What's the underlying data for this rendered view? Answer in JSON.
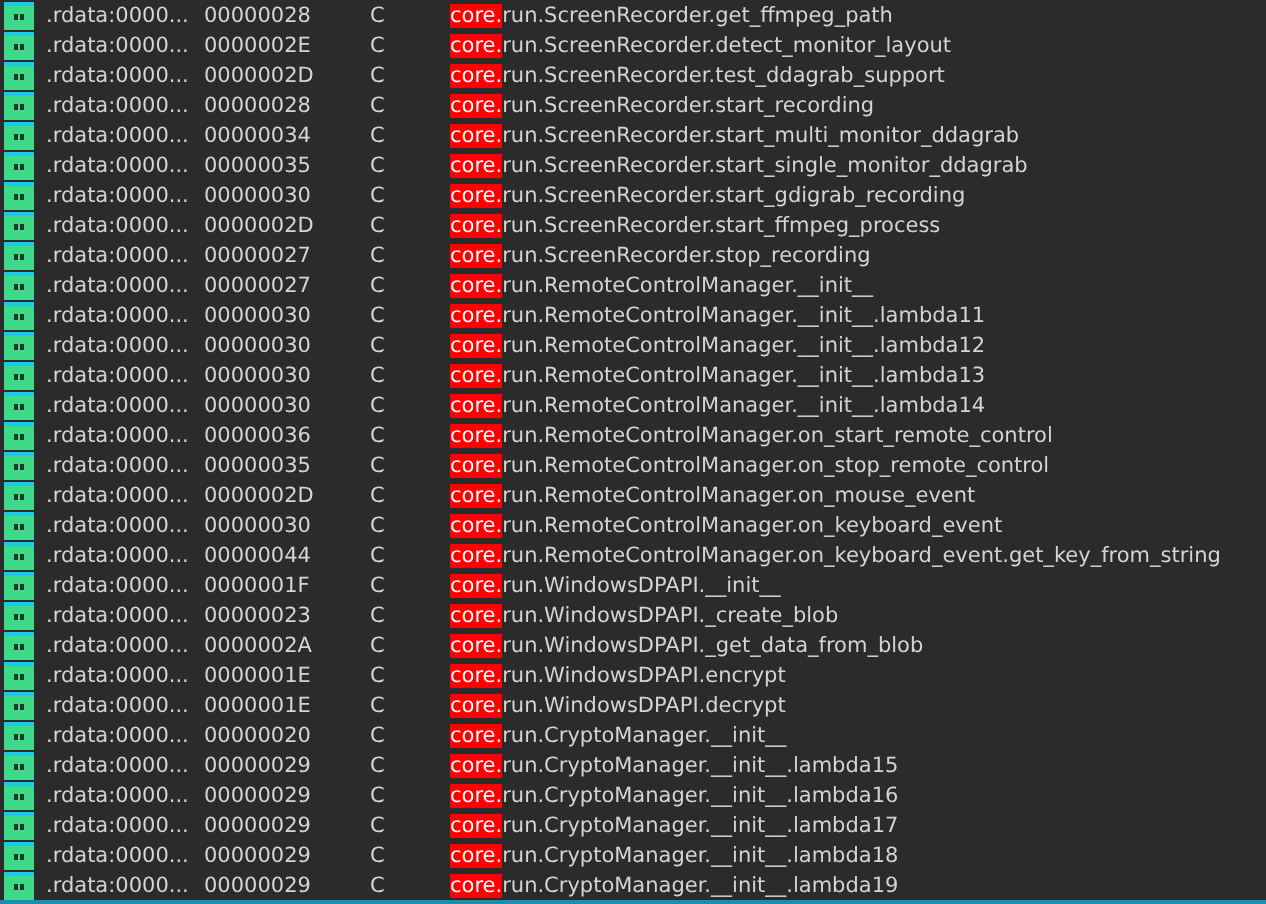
{
  "rows": [
    {
      "address": ".rdata:0000...",
      "length": "00000028",
      "type": "C",
      "highlight": "core.",
      "rest": "run.ScreenRecorder.get_ffmpeg_path"
    },
    {
      "address": ".rdata:0000...",
      "length": "0000002E",
      "type": "C",
      "highlight": "core.",
      "rest": "run.ScreenRecorder.detect_monitor_layout"
    },
    {
      "address": ".rdata:0000...",
      "length": "0000002D",
      "type": "C",
      "highlight": "core.",
      "rest": "run.ScreenRecorder.test_ddagrab_support"
    },
    {
      "address": ".rdata:0000...",
      "length": "00000028",
      "type": "C",
      "highlight": "core.",
      "rest": "run.ScreenRecorder.start_recording"
    },
    {
      "address": ".rdata:0000...",
      "length": "00000034",
      "type": "C",
      "highlight": "core.",
      "rest": "run.ScreenRecorder.start_multi_monitor_ddagrab"
    },
    {
      "address": ".rdata:0000...",
      "length": "00000035",
      "type": "C",
      "highlight": "core.",
      "rest": "run.ScreenRecorder.start_single_monitor_ddagrab"
    },
    {
      "address": ".rdata:0000...",
      "length": "00000030",
      "type": "C",
      "highlight": "core.",
      "rest": "run.ScreenRecorder.start_gdigrab_recording"
    },
    {
      "address": ".rdata:0000...",
      "length": "0000002D",
      "type": "C",
      "highlight": "core.",
      "rest": "run.ScreenRecorder.start_ffmpeg_process"
    },
    {
      "address": ".rdata:0000...",
      "length": "00000027",
      "type": "C",
      "highlight": "core.",
      "rest": "run.ScreenRecorder.stop_recording"
    },
    {
      "address": ".rdata:0000...",
      "length": "00000027",
      "type": "C",
      "highlight": "core.",
      "rest": "run.RemoteControlManager.__init__"
    },
    {
      "address": ".rdata:0000...",
      "length": "00000030",
      "type": "C",
      "highlight": "core.",
      "rest": "run.RemoteControlManager.__init__.lambda11"
    },
    {
      "address": ".rdata:0000...",
      "length": "00000030",
      "type": "C",
      "highlight": "core.",
      "rest": "run.RemoteControlManager.__init__.lambda12"
    },
    {
      "address": ".rdata:0000...",
      "length": "00000030",
      "type": "C",
      "highlight": "core.",
      "rest": "run.RemoteControlManager.__init__.lambda13"
    },
    {
      "address": ".rdata:0000...",
      "length": "00000030",
      "type": "C",
      "highlight": "core.",
      "rest": "run.RemoteControlManager.__init__.lambda14"
    },
    {
      "address": ".rdata:0000...",
      "length": "00000036",
      "type": "C",
      "highlight": "core.",
      "rest": "run.RemoteControlManager.on_start_remote_control"
    },
    {
      "address": ".rdata:0000...",
      "length": "00000035",
      "type": "C",
      "highlight": "core.",
      "rest": "run.RemoteControlManager.on_stop_remote_control"
    },
    {
      "address": ".rdata:0000...",
      "length": "0000002D",
      "type": "C",
      "highlight": "core.",
      "rest": "run.RemoteControlManager.on_mouse_event"
    },
    {
      "address": ".rdata:0000...",
      "length": "00000030",
      "type": "C",
      "highlight": "core.",
      "rest": "run.RemoteControlManager.on_keyboard_event"
    },
    {
      "address": ".rdata:0000...",
      "length": "00000044",
      "type": "C",
      "highlight": "core.",
      "rest": "run.RemoteControlManager.on_keyboard_event.get_key_from_string"
    },
    {
      "address": ".rdata:0000...",
      "length": "0000001F",
      "type": "C",
      "highlight": "core.",
      "rest": "run.WindowsDPAPI.__init__"
    },
    {
      "address": ".rdata:0000...",
      "length": "00000023",
      "type": "C",
      "highlight": "core.",
      "rest": "run.WindowsDPAPI._create_blob"
    },
    {
      "address": ".rdata:0000...",
      "length": "0000002A",
      "type": "C",
      "highlight": "core.",
      "rest": "run.WindowsDPAPI._get_data_from_blob"
    },
    {
      "address": ".rdata:0000...",
      "length": "0000001E",
      "type": "C",
      "highlight": "core.",
      "rest": "run.WindowsDPAPI.encrypt"
    },
    {
      "address": ".rdata:0000...",
      "length": "0000001E",
      "type": "C",
      "highlight": "core.",
      "rest": "run.WindowsDPAPI.decrypt"
    },
    {
      "address": ".rdata:0000...",
      "length": "00000020",
      "type": "C",
      "highlight": "core.",
      "rest": "run.CryptoManager.__init__"
    },
    {
      "address": ".rdata:0000...",
      "length": "00000029",
      "type": "C",
      "highlight": "core.",
      "rest": "run.CryptoManager.__init__.lambda15"
    },
    {
      "address": ".rdata:0000...",
      "length": "00000029",
      "type": "C",
      "highlight": "core.",
      "rest": "run.CryptoManager.__init__.lambda16"
    },
    {
      "address": ".rdata:0000...",
      "length": "00000029",
      "type": "C",
      "highlight": "core.",
      "rest": "run.CryptoManager.__init__.lambda17"
    },
    {
      "address": ".rdata:0000...",
      "length": "00000029",
      "type": "C",
      "highlight": "core.",
      "rest": "run.CryptoManager.__init__.lambda18"
    },
    {
      "address": ".rdata:0000...",
      "length": "00000029",
      "type": "C",
      "highlight": "core.",
      "rest": "run.CryptoManager.__init__.lambda19"
    }
  ]
}
